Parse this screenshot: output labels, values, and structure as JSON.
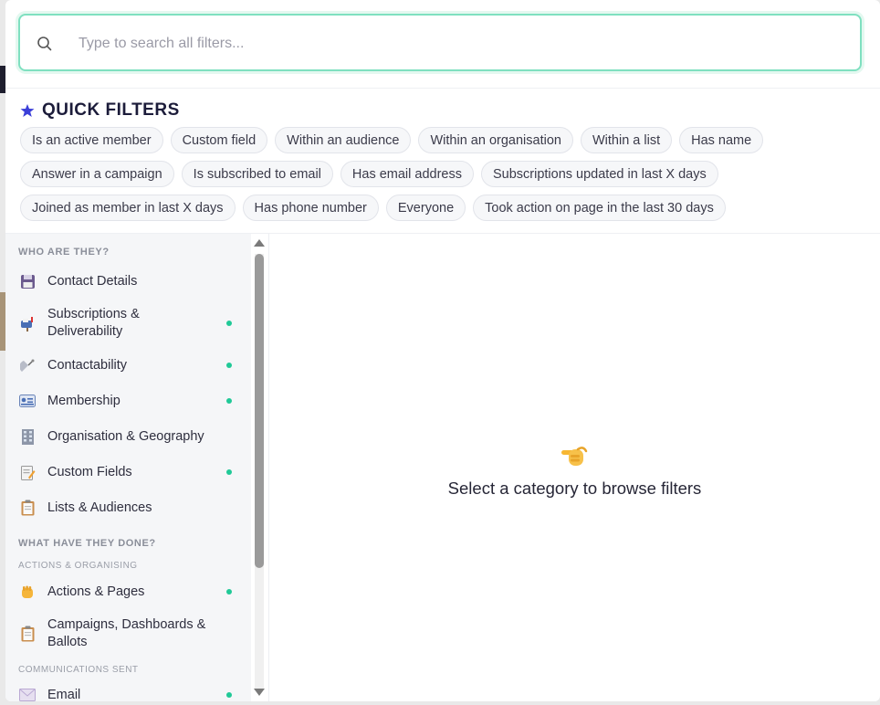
{
  "search": {
    "placeholder": "Type to search all filters..."
  },
  "quick_filters": {
    "title": "QUICK FILTERS",
    "rows": [
      [
        "Is an active member",
        "Custom field",
        "Within an audience",
        "Within an organisation",
        "Within a list",
        "Has name"
      ],
      [
        "Answer in a campaign",
        "Is subscribed to email",
        "Has email address",
        "Subscriptions updated in last X days"
      ],
      [
        "Joined as member in last X days",
        "Has phone number",
        "Everyone",
        "Took action on page in the last 30 days"
      ]
    ]
  },
  "sidebar": {
    "section1": "WHO ARE THEY?",
    "section2": "WHAT HAVE THEY DONE?",
    "sub_actions": "ACTIONS & ORGANISING",
    "sub_comms": "COMMUNICATIONS SENT",
    "items": [
      {
        "label": "Contact Details",
        "icon": "floppy-disk-icon",
        "active_dot": false
      },
      {
        "label": "Subscriptions & Deliverability",
        "icon": "mailbox-icon",
        "active_dot": true
      },
      {
        "label": "Contactability",
        "icon": "satellite-dish-icon",
        "active_dot": true
      },
      {
        "label": "Membership",
        "icon": "id-card-icon",
        "active_dot": true
      },
      {
        "label": "Organisation & Geography",
        "icon": "office-building-icon",
        "active_dot": false
      },
      {
        "label": "Custom Fields",
        "icon": "memo-icon",
        "active_dot": true
      },
      {
        "label": "Lists & Audiences",
        "icon": "clipboard-icon",
        "active_dot": false
      },
      {
        "label": "Actions & Pages",
        "icon": "raised-fist-icon",
        "active_dot": true
      },
      {
        "label": "Campaigns, Dashboards & Ballots",
        "icon": "clipboard-icon",
        "active_dot": false
      },
      {
        "label": "Email",
        "icon": "envelope-icon",
        "active_dot": true
      }
    ]
  },
  "empty_state": {
    "icon": "pointing-hand-icon",
    "message": "Select a category to browse filters"
  },
  "colors": {
    "accent_border": "#7fe0c0",
    "dot": "#20c997",
    "star": "#3b3fd8"
  }
}
